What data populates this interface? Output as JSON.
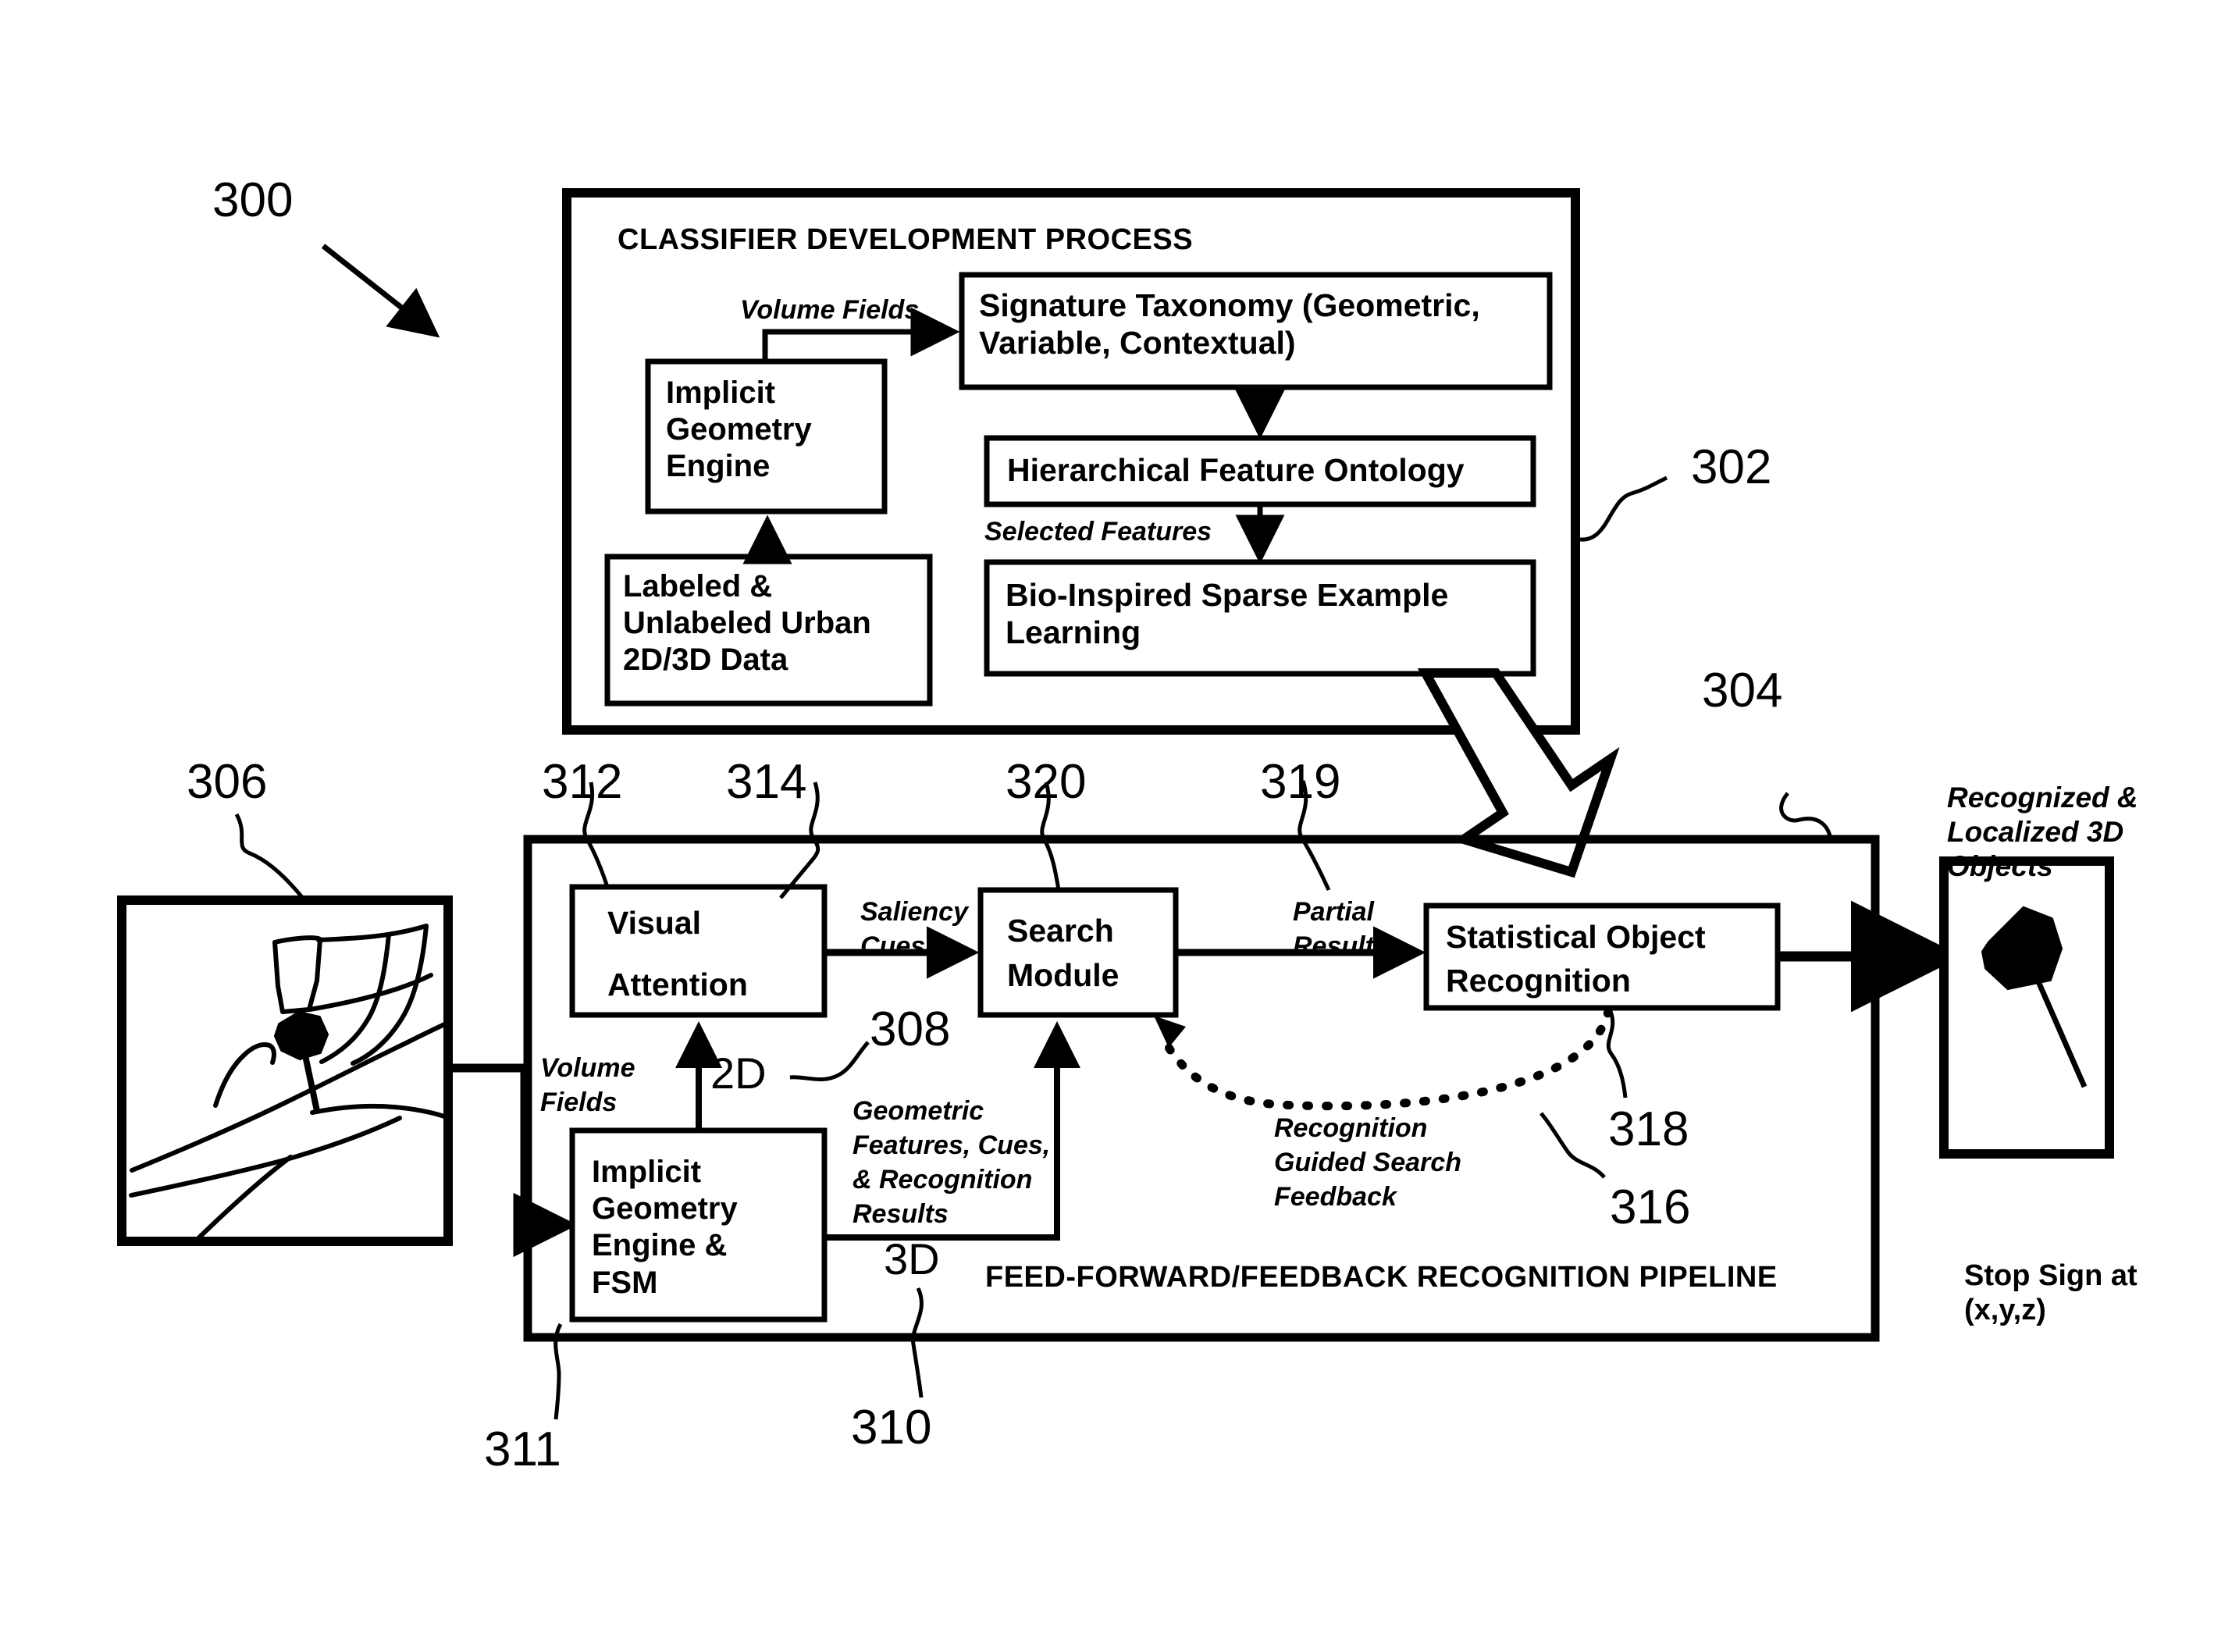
{
  "figure": {
    "ref_main": "300",
    "classifier_block": {
      "ref": "302",
      "title": "CLASSIFIER DEVELOPMENT PROCESS",
      "boxes": {
        "implicit_geometry_engine": "Implicit\nGeometry\nEngine",
        "labeled_data": "Labeled &\nUnlabeled Urban\n2D/3D Data",
        "signature_taxonomy": "Signature Taxonomy (Geometric,\nVariable, Contextual)",
        "hierarchical_feature_ontology": "Hierarchical Feature Ontology",
        "bio_inspired": "Bio-Inspired Sparse Example\nLearning"
      },
      "edge_labels": {
        "volume_fields": "Volume Fields",
        "selected_features": "Selected Features"
      }
    },
    "pipeline_block": {
      "ref": "304",
      "title": "FEED-FORWARD/FEEDBACK RECOGNITION PIPELINE",
      "boxes": {
        "visual_attention": "Visual\n\nAttention",
        "visual_attention_l1": "Visual",
        "visual_attention_l2": "Attention",
        "search_module": "Search\nModule",
        "search_module_l1": "Search",
        "search_module_l2": "Module",
        "statistical_object_recognition": "Statistical Object\nRecognition",
        "sor_l1": "Statistical Object",
        "sor_l2": "Recognition",
        "implicit_geometry_engine_fsm": "Implicit\nGeometry\nEngine &\nFSM"
      },
      "edge_labels": {
        "saliency_cues": "Saliency\nCues",
        "saliency_cues_l1": "Saliency",
        "saliency_cues_l2": "Cues",
        "partial_results_l1": "Partial",
        "partial_results_l2": "Results",
        "volume_fields_l1": "Volume",
        "volume_fields_l2": "Fields",
        "geometric_features_l1": "Geometric",
        "geometric_features_l2": "Features, Cues,",
        "geometric_features_l3": "& Recognition",
        "geometric_features_l4": "Results",
        "feedback_l1": "Recognition",
        "feedback_l2": "Guided Search",
        "feedback_l3": "Feedback",
        "two_d": "2D",
        "three_d": "3D"
      },
      "refs": {
        "visual_attention": "312",
        "saliency_path": "314",
        "search_module": "320",
        "partial_results": "319",
        "two_d_link": "308",
        "feedback": "316",
        "statistical_recognition": "318",
        "ige_fsm": "311",
        "three_d_link": "310"
      }
    },
    "input_image": {
      "ref": "306",
      "description": "urban scene sketch with stop sign"
    },
    "output_image": {
      "caption_l1": "Recognized &",
      "caption_l2": "Localized 3D",
      "caption_l3": "Objects",
      "label_l1": "Stop Sign at",
      "label_l2": "(x,y,z)"
    },
    "colors": {
      "ink": "#000000",
      "paper": "#ffffff"
    }
  }
}
